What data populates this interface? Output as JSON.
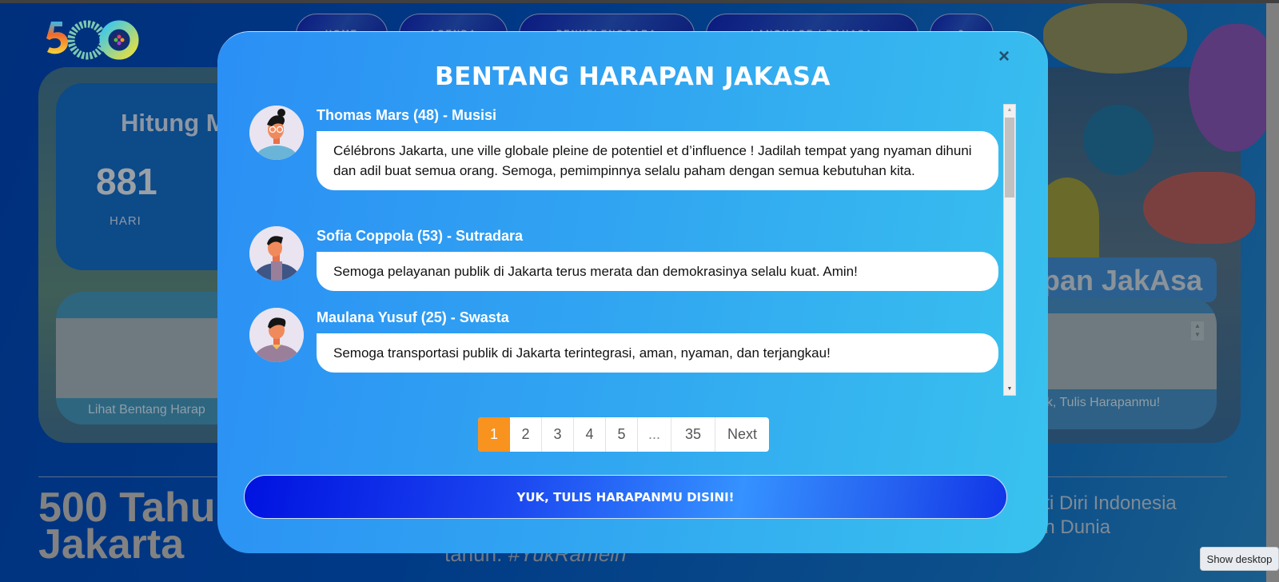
{
  "page": {
    "nav": [
      "HOME",
      "AGENDA",
      "PENYELENGGARA",
      "LANGUAGE / BAHASA",
      "?"
    ],
    "countdown": {
      "title": "Hitung M",
      "value": "881",
      "unit": "HARI"
    },
    "left_card_link": "Lihat Bentang Harap",
    "right_card_title": "pan JakAsa",
    "right_card_link": "uk, Tulis Harapanmu!",
    "big_title_line1": "500 Tahu",
    "big_title_line2": "Jakarta",
    "tagline_prefix": "tahun.",
    "tagline_hashtag": "#YukRamein",
    "right_subtitle_line1": "ati Diri Indonesia",
    "right_subtitle_line2": "an Dunia",
    "spinner_up": "▲",
    "spinner_down": "▼"
  },
  "modal": {
    "title": "BENTANG HARAPAN JAKASA",
    "close_label": "×",
    "wishes": [
      {
        "name": "Thomas Mars (48) - Musisi",
        "text": "Célébrons Jakarta, une ville globale pleine de potentiel et d’influence ! Jadilah tempat yang nyaman dihuni dan adil buat semua orang. Semoga, pemimpinnya selalu paham dengan semua kebutuhan kita.",
        "avatar": "avatar-glasses-man"
      },
      {
        "name": "Sofia Coppola (53) - Sutradara",
        "text": "Semoga pelayanan publik di Jakarta terus merata dan demokrasinya selalu kuat. Amin!",
        "avatar": "avatar-jacket-man"
      },
      {
        "name": "Maulana Yusuf (25) - Swasta",
        "text": "Semoga transportasi publik di Jakarta terintegrasi, aman, nyaman, dan terjangkau!",
        "avatar": "avatar-collar-man"
      }
    ],
    "pagination": {
      "pages": [
        "1",
        "2",
        "3",
        "4",
        "5",
        "...",
        "35"
      ],
      "current": "1",
      "next_label": "Next"
    },
    "cta_label": "YUK, TULIS HARAPANMU DISINI!",
    "scroll_up": "▲",
    "scroll_down": "▼"
  },
  "taskbar_tooltip": "Show desktop",
  "colors": {
    "modal_start": "#2b8ff5",
    "modal_end": "#39c2ee",
    "active_page": "#f7931e",
    "cta_start": "#0012e0",
    "cta_mid": "#3592ff"
  }
}
